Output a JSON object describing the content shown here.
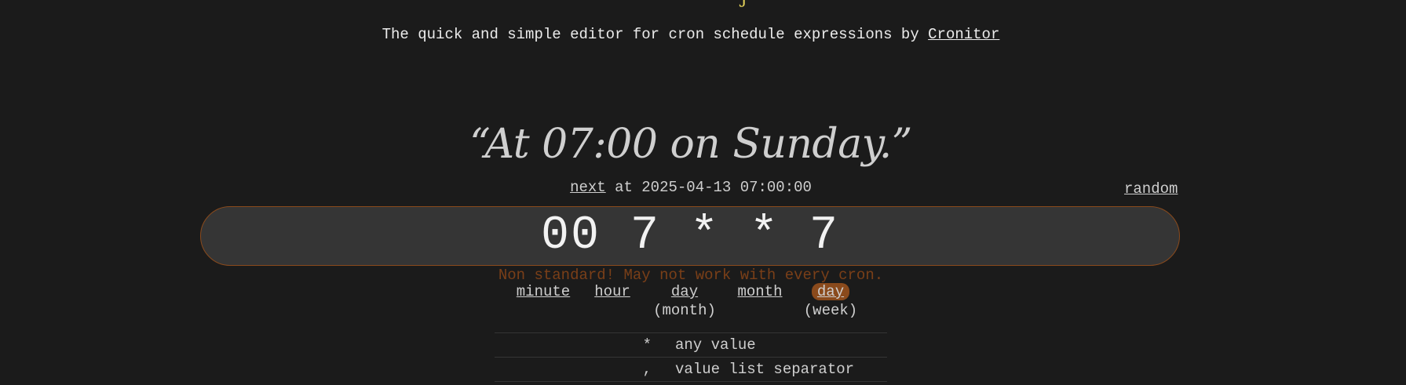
{
  "header": {
    "subtitle_text": "The quick and simple editor for cron schedule expressions by ",
    "brand_link": "Cronitor"
  },
  "human_readable": "“At 07:00 on Sunday.”",
  "next_run": {
    "link_label": "next",
    "text": " at 2025-04-13 07:00:00"
  },
  "random_label": "random",
  "cron_expression": "00 7 * * 7",
  "warning": "Non standard! May not work with every cron.",
  "parts": [
    {
      "label": "day",
      "sub": "(month)"
    },
    {
      "label": "minute",
      "sub": ""
    },
    {
      "label": "hour",
      "sub": ""
    },
    {
      "label": "month",
      "sub": ""
    },
    {
      "label": "day",
      "sub": "(week)"
    }
  ],
  "legend": [
    {
      "symbol": "*",
      "description": "any value"
    },
    {
      "symbol": ",",
      "description": "value list separator"
    }
  ],
  "colors": {
    "background": "#1b1b1b",
    "accent": "#8a4a1c",
    "input_bg": "#353535",
    "logo": "#e5d35a"
  }
}
